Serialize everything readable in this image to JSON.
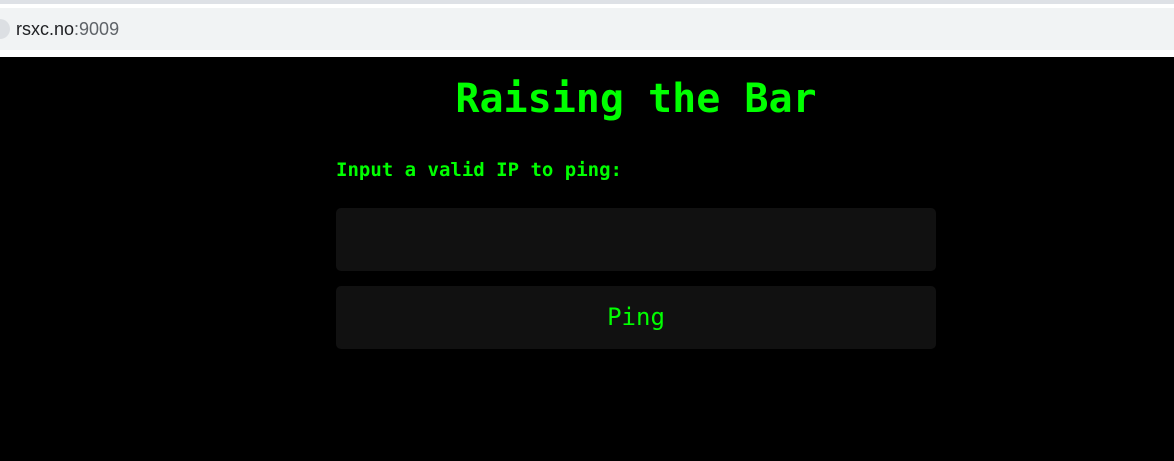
{
  "browser": {
    "url_host": "rsxc.no",
    "url_port": ":9009"
  },
  "page": {
    "title": "Raising the Bar",
    "prompt_label": "Input a valid IP to ping:",
    "ip_input_value": "",
    "ip_input_placeholder": "",
    "ping_button_label": "Ping"
  },
  "colors": {
    "background": "#000000",
    "accent_green": "#00ff00",
    "field_background": "#111111"
  }
}
